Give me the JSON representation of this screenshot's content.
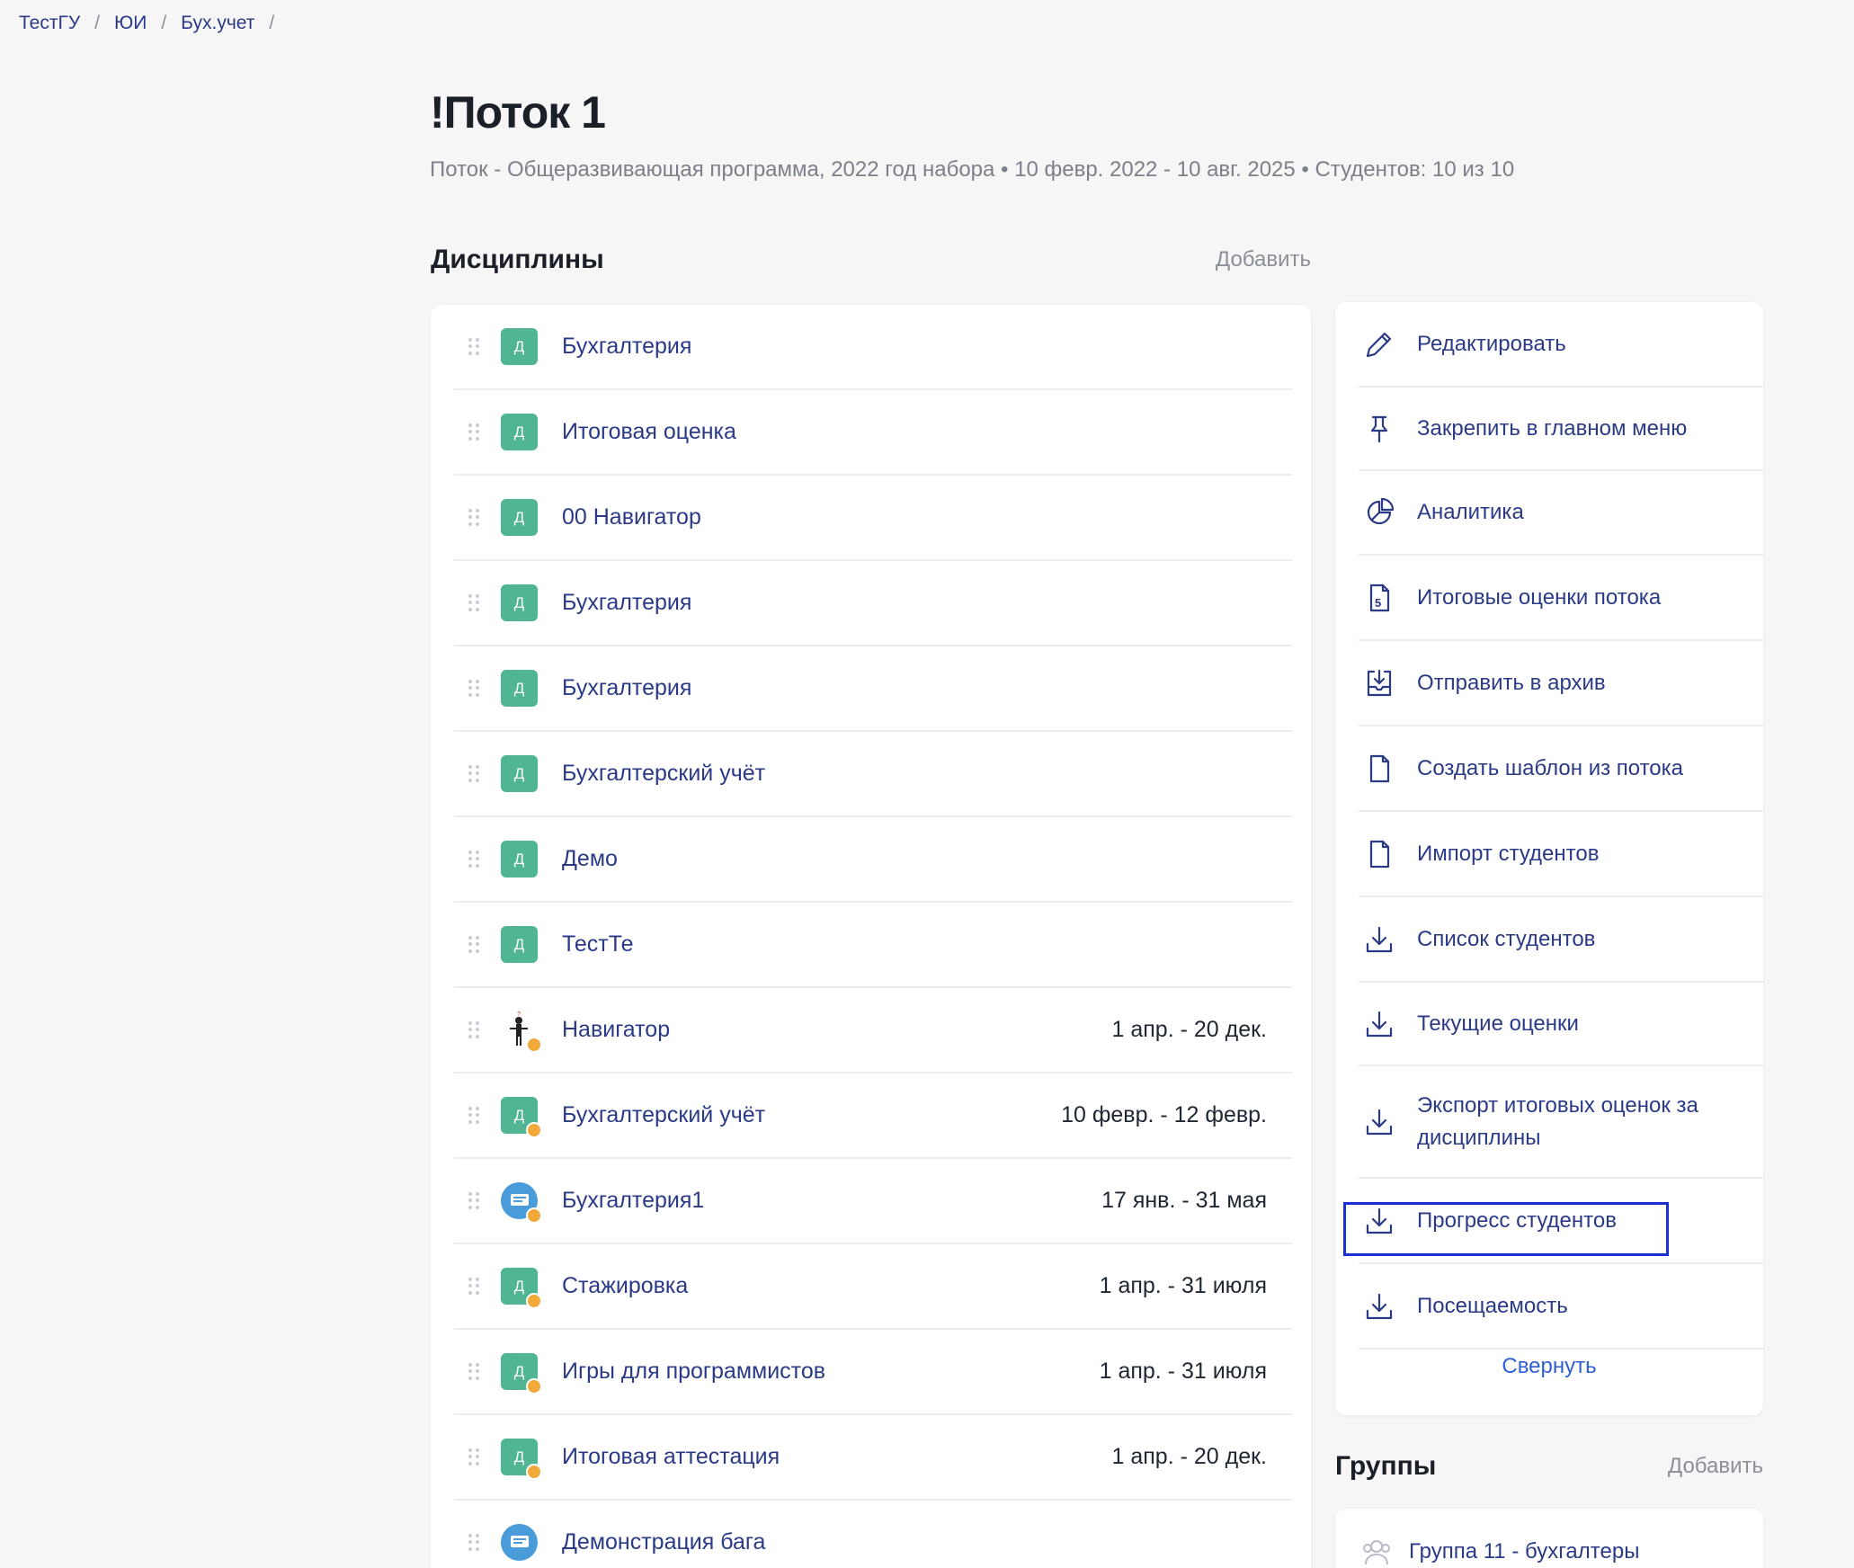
{
  "breadcrumb": [
    "ТестГУ",
    "ЮИ",
    "Бух.учет"
  ],
  "page": {
    "title": "!Поток 1",
    "subtitle": "Поток - Общеразвивающая программа, 2022 год набора • 10 февр. 2022 - 10 авг. 2025 • Студентов: 10 из 10"
  },
  "disciplines": {
    "title": "Дисциплины",
    "add_label": "Добавить",
    "items": [
      {
        "badge": "Д",
        "name": "Бухгалтерия",
        "date": ""
      },
      {
        "badge": "Д",
        "name": "Итоговая оценка",
        "date": ""
      },
      {
        "badge": "Д",
        "name": "00 Навигатор",
        "date": ""
      },
      {
        "badge": "Д",
        "name": "Бухгалтерия",
        "date": ""
      },
      {
        "badge": "Д",
        "name": "Бухгалтерия",
        "date": ""
      },
      {
        "badge": "Д",
        "name": "Бухгалтерский учёт",
        "date": ""
      },
      {
        "badge": "Д",
        "name": "Демо",
        "date": ""
      },
      {
        "badge": "Д",
        "name": "ТестТе",
        "date": ""
      },
      {
        "badge": "",
        "name": "Навигатор",
        "date": "1 апр. - 20 дек."
      },
      {
        "badge": "Д",
        "name": "Бухгалтерский учёт",
        "date": "10 февр. - 12 февр."
      },
      {
        "badge": "",
        "name": "Бухгалтерия1",
        "date": "17 янв. - 31 мая"
      },
      {
        "badge": "Д",
        "name": "Стажировка",
        "date": "1 апр. - 31 июля"
      },
      {
        "badge": "Д",
        "name": "Игры для программистов",
        "date": "1 апр. - 31 июля"
      },
      {
        "badge": "Д",
        "name": "Итоговая аттестация",
        "date": "1 апр. - 20 дек."
      },
      {
        "badge": "",
        "name": "Демонстрация бага",
        "date": ""
      }
    ]
  },
  "actions": {
    "items": [
      {
        "icon": "pencil-icon",
        "label": "Редактировать"
      },
      {
        "icon": "pin-icon",
        "label": "Закрепить в главном меню"
      },
      {
        "icon": "pie-chart-icon",
        "label": "Аналитика"
      },
      {
        "icon": "grade-document-icon",
        "label": "Итоговые оценки потока"
      },
      {
        "icon": "archive-icon",
        "label": "Отправить в архив"
      },
      {
        "icon": "document-icon",
        "label": "Создать шаблон из потока"
      },
      {
        "icon": "document-icon",
        "label": "Импорт студентов"
      },
      {
        "icon": "download-icon",
        "label": "Список студентов"
      },
      {
        "icon": "download-icon",
        "label": "Текущие оценки"
      },
      {
        "icon": "download-icon",
        "label": "Экспорт итоговых оценок за дисциплины"
      },
      {
        "icon": "download-icon",
        "label": "Прогресс студентов"
      },
      {
        "icon": "download-icon",
        "label": "Посещаемость"
      }
    ],
    "collapse_label": "Свернуть"
  },
  "groups": {
    "title": "Группы",
    "add_label": "Добавить",
    "items": [
      {
        "icon": "users-icon",
        "name": "Группа 11 - бухгалтеры"
      }
    ]
  }
}
